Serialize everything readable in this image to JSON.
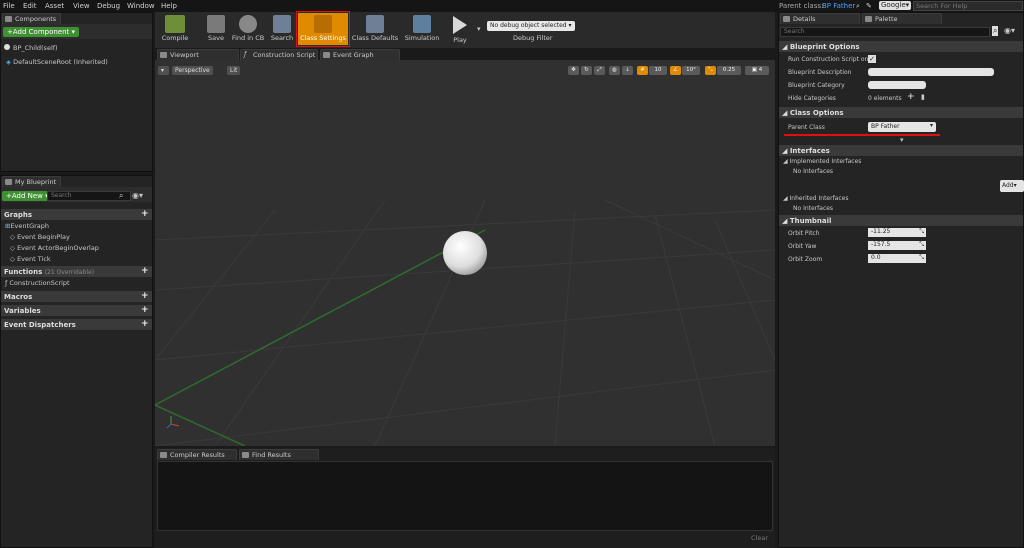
{
  "menu": [
    "File",
    "Edit",
    "Asset",
    "View",
    "Debug",
    "Window",
    "Help"
  ],
  "top_right": {
    "parent_label": "Parent class:",
    "parent_value": "BP Father",
    "search_engine": "Google▾",
    "search_placeholder": "Search For Help"
  },
  "components": {
    "tab": "Components",
    "add_button": "+Add Component ▾",
    "root_item": "BP_Child(self)",
    "child_item": "DefaultSceneRoot (Inherited)"
  },
  "my_blueprint": {
    "tab": "My Blueprint",
    "add_new": "+Add New ▾",
    "search_placeholder": "Search",
    "graphs_header": "Graphs",
    "event_graph": "EventGraph",
    "events": [
      "Event BeginPlay",
      "Event ActorBeginOverlap",
      "Event Tick"
    ],
    "functions_header": "Functions",
    "functions_note": "(21 Overridable)",
    "construction_script": "ConstructionScript",
    "macros": "Macros",
    "variables": "Variables",
    "event_dispatchers": "Event Dispatchers"
  },
  "toolbar": {
    "compile": "Compile",
    "save": "Save",
    "find_in_cb": "Find in CB",
    "search": "Search",
    "class_settings": "Class Settings",
    "class_defaults": "Class Defaults",
    "simulation": "Simulation",
    "play": "Play",
    "debug_select": "No debug object selected ▾",
    "debug_filter": "Debug Filter"
  },
  "editor_tabs": {
    "viewport": "Viewport",
    "construction_script": "Construction Script",
    "event_graph": "Event Graph"
  },
  "viewport": {
    "perspective": "Perspective",
    "lit": "Lit",
    "grid_snap": "10",
    "rot_snap": "10°",
    "scale_snap": "0.25",
    "cam_speed": "4"
  },
  "bottom": {
    "compiler_results": "Compiler Results",
    "find_results": "Find Results",
    "clear": "Clear"
  },
  "details": {
    "tab_details": "Details",
    "tab_palette": "Palette",
    "search_placeholder": "Search",
    "blueprint_options": "Blueprint Options",
    "run_construction": "Run Construction Script on D",
    "blueprint_description": "Blueprint Description",
    "blueprint_category": "Blueprint Category",
    "hide_categories": "Hide Categories",
    "hide_categories_value": "0 elements",
    "class_options": "Class Options",
    "parent_class": "Parent Class",
    "parent_class_value": "BP Father",
    "interfaces": "Interfaces",
    "implemented_interfaces": "Implemented Interfaces",
    "no_interfaces_1": "No Interfaces",
    "add": "Add▾",
    "inherited_interfaces": "Inherited Interfaces",
    "no_interfaces_2": "No Interfaces",
    "thumbnail": "Thumbnail",
    "orbit_pitch": "Orbit Pitch",
    "orbit_pitch_value": "-11.25",
    "orbit_yaw": "Orbit Yaw",
    "orbit_yaw_value": "-157.5",
    "orbit_zoom": "Orbit Zoom",
    "orbit_zoom_value": "0.0"
  },
  "colors": {
    "accent_green": "#3f8f33",
    "highlight_orange": "#e08a00",
    "annotation_red": "#e01010"
  }
}
